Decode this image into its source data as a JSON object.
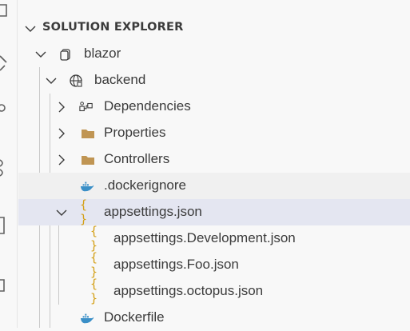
{
  "section": {
    "title": "SOLUTION EXPLORER"
  },
  "tree": {
    "solution": {
      "label": "blazor"
    },
    "project": {
      "label": "backend"
    },
    "items": {
      "dependencies": "Dependencies",
      "properties": "Properties",
      "controllers": "Controllers",
      "dockerignore": ".dockerignore",
      "appsettings": "appsettings.json",
      "appsettings_development": "appsettings.Development.json",
      "appsettings_foo": "appsettings.Foo.json",
      "appsettings_octopus": "appsettings.octopus.json",
      "dockerfile": "Dockerfile"
    }
  },
  "colors": {
    "folder": "#c09553",
    "json": "#d4a017",
    "docker": "#3a8fc7",
    "selected_bg": "#e4e6f1",
    "hover_bg": "#f0f0f0"
  },
  "icons": {
    "dependencies": "dependencies-icon",
    "folder": "folder-icon",
    "docker": "docker-whale-icon",
    "json": "json-braces-icon",
    "solution": "solution-icon",
    "project": "globe-project-icon"
  }
}
